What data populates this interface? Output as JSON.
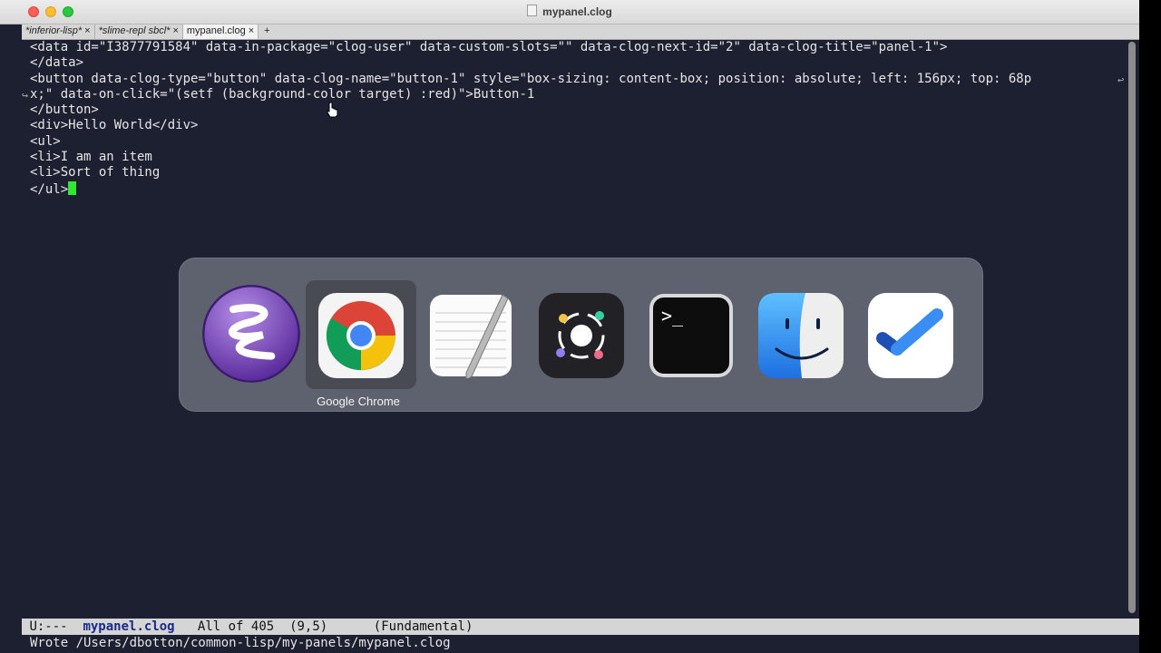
{
  "window": {
    "title": "mypanel.clog"
  },
  "tabs": [
    {
      "label": "*inferior-lisp*",
      "close": "×",
      "modified": true,
      "active": false
    },
    {
      "label": "*slime-repl sbcl*",
      "close": "×",
      "modified": true,
      "active": false
    },
    {
      "label": "mypanel.clog",
      "close": "×",
      "modified": false,
      "active": true
    }
  ],
  "new_tab_label": "+",
  "editor": {
    "lines": [
      "<data id=\"I3877791584\" data-in-package=\"clog-user\" data-custom-slots=\"\" data-clog-next-id=\"2\" data-clog-title=\"panel-1\">",
      "</data>",
      "<button data-clog-type=\"button\" data-clog-name=\"button-1\" style=\"box-sizing: content-box; position: absolute; left: 156px; top: 68p",
      "x;\" data-on-click=\"(setf (background-color target) :red)\">Button-1",
      "</button>",
      "<div>Hello World</div>",
      "<ul>",
      "<li>I am an item",
      "<li>Sort of thing",
      "</ul>"
    ]
  },
  "modeline": {
    "status": "U:---",
    "buffer": "mypanel.clog",
    "position": "All of 405",
    "cursor": "(9,5)",
    "mode": "(Fundamental)"
  },
  "echo_area": "Wrote /Users/dbotton/common-lisp/my-panels/mypanel.clog",
  "app_switcher": {
    "selected_label": "Google Chrome",
    "apps": [
      {
        "name": "Emacs",
        "icon": "emacs-icon"
      },
      {
        "name": "Google Chrome",
        "icon": "chrome-icon",
        "selected": true
      },
      {
        "name": "TextEdit",
        "icon": "textedit-icon"
      },
      {
        "name": "App",
        "icon": "dots-app-icon"
      },
      {
        "name": "Terminal",
        "icon": "terminal-icon"
      },
      {
        "name": "Finder",
        "icon": "finder-icon"
      },
      {
        "name": "Tasks",
        "icon": "checkmark-app-icon"
      }
    ]
  },
  "colors": {
    "editor_bg": "#1c2030",
    "cursor": "#34e634",
    "buffer_name": "#1a2a8a"
  }
}
